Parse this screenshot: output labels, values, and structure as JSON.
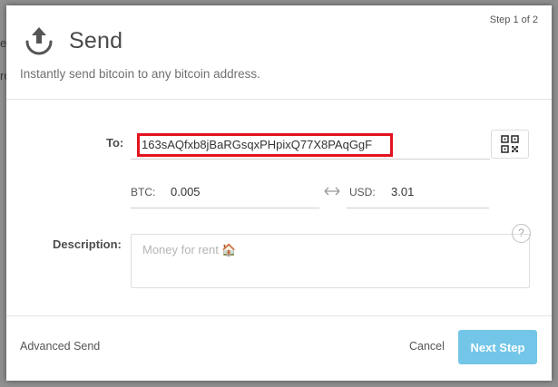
{
  "background": {
    "fragments": [
      "e",
      "ro"
    ]
  },
  "modal": {
    "step": "Step 1 of 2",
    "title": "Send",
    "subtitle": "Instantly send bitcoin to any bitcoin address.",
    "to_label": "To:",
    "to_address": "163sAQfxb8jBaRGsqxPHpixQ77X8PAqGgF",
    "btc_label": "BTC:",
    "btc_value": "0.005",
    "usd_label": "USD:",
    "usd_value": "3.01",
    "description_label": "Description:",
    "description_placeholder": "Money for rent 🏠",
    "help": "?",
    "advanced_send": "Advanced Send",
    "cancel": "Cancel",
    "next_step": "Next Step"
  },
  "colors": {
    "highlight_border": "#e3141f",
    "next_button": "#73c6e8",
    "overlay": "#8f8f8f"
  },
  "icons": [
    "upload-arrow-icon",
    "qr-code-icon",
    "swap-arrows-icon",
    "help-icon",
    "house-icon"
  ]
}
